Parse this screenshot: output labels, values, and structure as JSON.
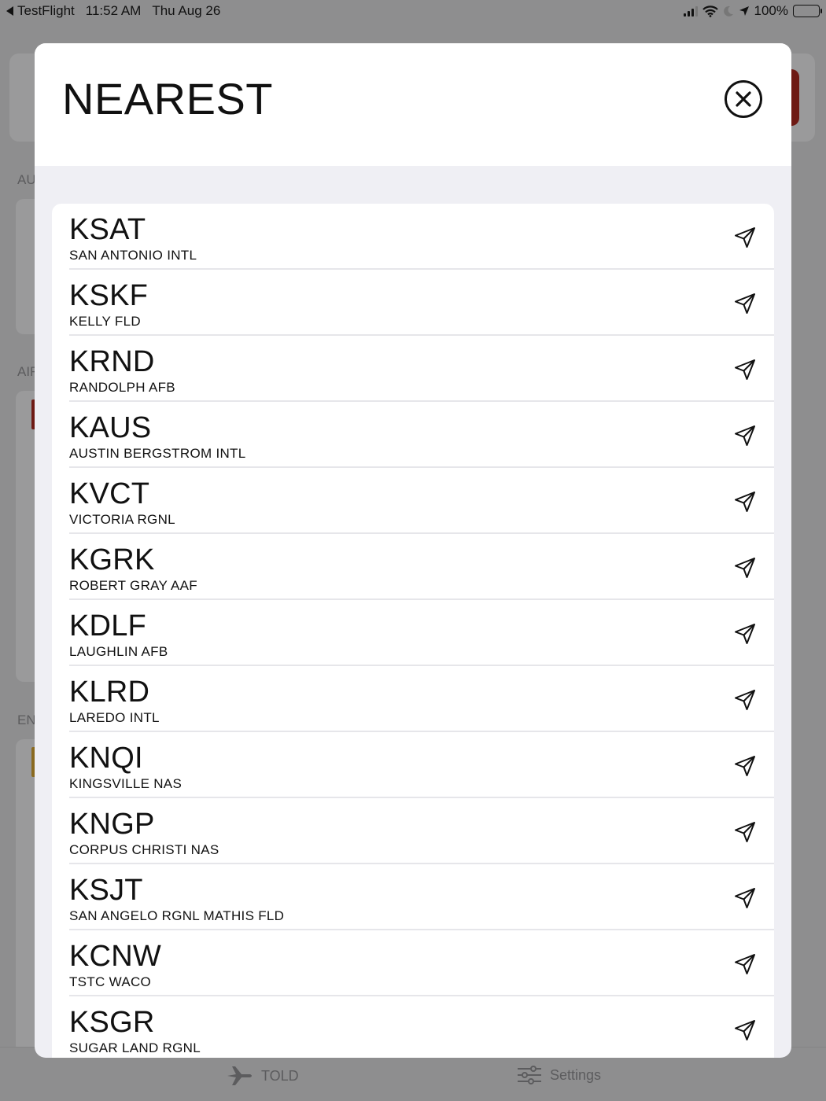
{
  "status_bar": {
    "back_app": "TestFlight",
    "time": "11:52 AM",
    "date": "Thu Aug 26",
    "battery": "100%"
  },
  "background": {
    "section_labels": [
      "AU",
      "AIF",
      "EN"
    ],
    "tabs": [
      {
        "label": "TOLD",
        "icon": "airplane-icon"
      },
      {
        "label": "Settings",
        "icon": "sliders-icon"
      }
    ]
  },
  "modal": {
    "title": "NEAREST",
    "close_icon": "close-circle-icon"
  },
  "airports": [
    {
      "code": "KSAT",
      "name": "SAN ANTONIO INTL"
    },
    {
      "code": "KSKF",
      "name": "KELLY FLD"
    },
    {
      "code": "KRND",
      "name": "RANDOLPH AFB"
    },
    {
      "code": "KAUS",
      "name": "AUSTIN BERGSTROM INTL"
    },
    {
      "code": "KVCT",
      "name": "VICTORIA RGNL"
    },
    {
      "code": "KGRK",
      "name": "ROBERT GRAY AAF"
    },
    {
      "code": "KDLF",
      "name": "LAUGHLIN AFB"
    },
    {
      "code": "KLRD",
      "name": "LAREDO INTL"
    },
    {
      "code": "KNQI",
      "name": "KINGSVILLE NAS"
    },
    {
      "code": "KNGP",
      "name": "CORPUS CHRISTI NAS"
    },
    {
      "code": "KSJT",
      "name": "SAN ANGELO RGNL MATHIS FLD"
    },
    {
      "code": "KCNW",
      "name": "TSTC WACO"
    },
    {
      "code": "KSGR",
      "name": "SUGAR LAND RGNL"
    }
  ],
  "row_icon": "navigation-arrow-icon"
}
